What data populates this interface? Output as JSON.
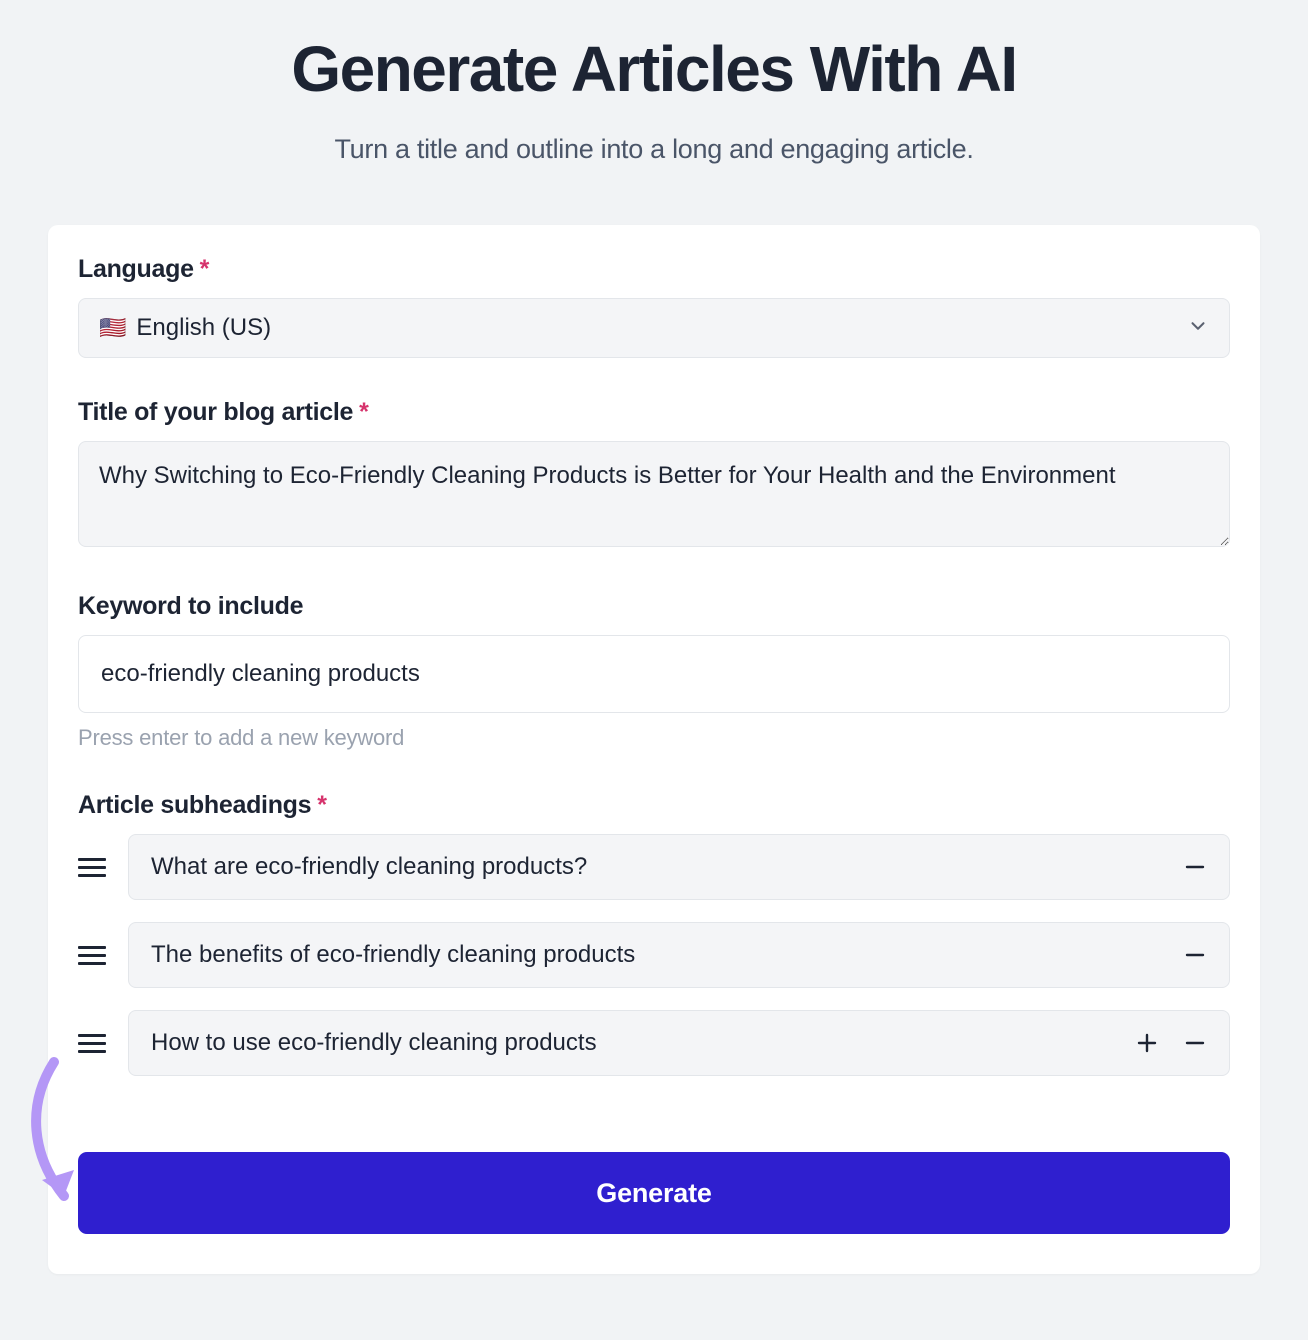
{
  "header": {
    "title": "Generate Articles With AI",
    "subtitle": "Turn a title and outline into a long and engaging article."
  },
  "form": {
    "language": {
      "label": "Language",
      "required_mark": "*",
      "flag": "🇺🇸",
      "value": "English (US)"
    },
    "title": {
      "label": "Title of your blog article",
      "required_mark": "*",
      "value": "Why Switching to Eco-Friendly Cleaning Products is Better for Your Health and the Environment"
    },
    "keyword": {
      "label": "Keyword to include",
      "value": "eco-friendly cleaning products",
      "helper": "Press enter to add a new keyword"
    },
    "subheadings": {
      "label": "Article subheadings",
      "required_mark": "*",
      "items": [
        {
          "text": "What are eco-friendly cleaning products?"
        },
        {
          "text": "The benefits of eco-friendly cleaning products"
        },
        {
          "text": "How to use eco-friendly cleaning products"
        }
      ]
    },
    "generate_label": "Generate"
  }
}
